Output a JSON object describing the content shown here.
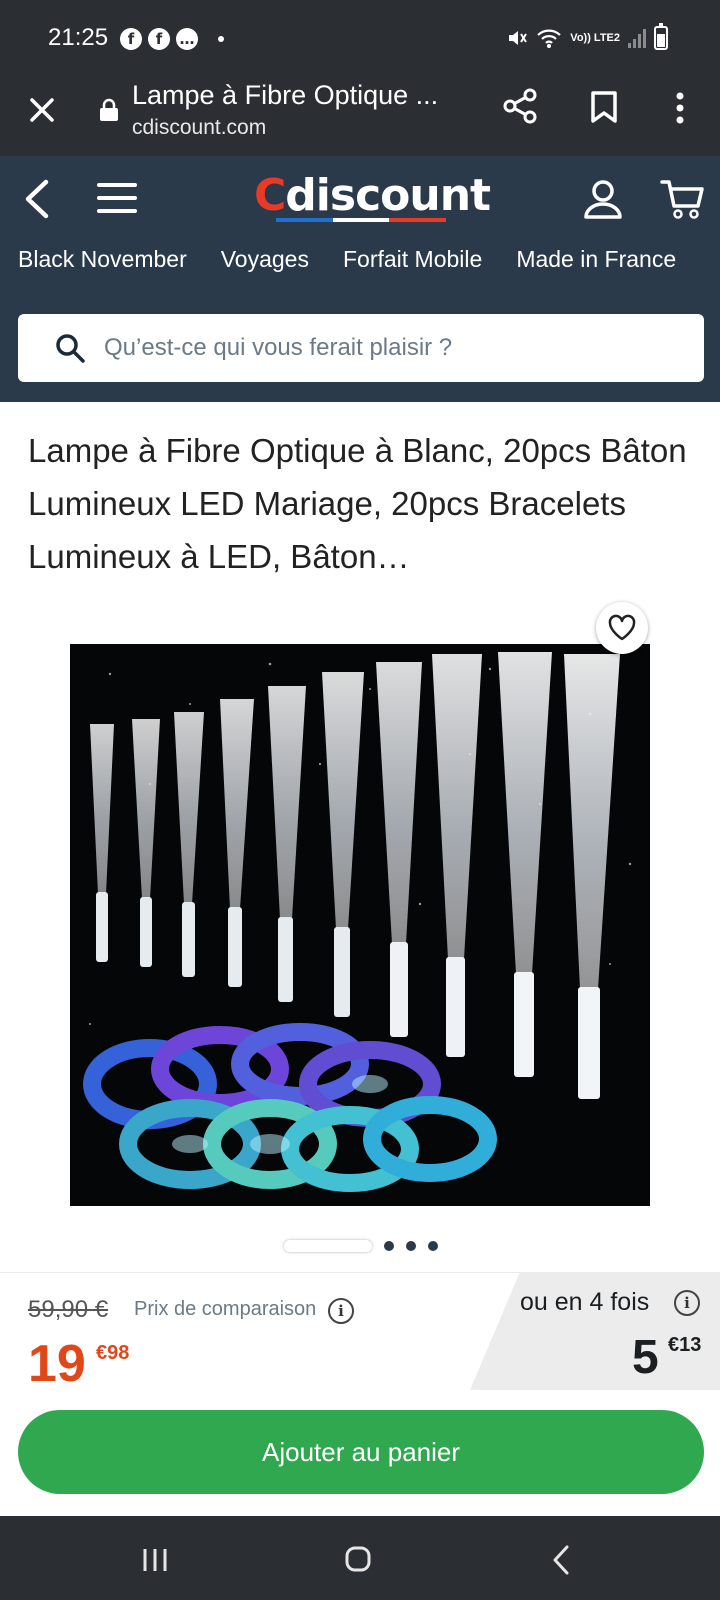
{
  "status_bar": {
    "time": "21:25",
    "left_icons": [
      "facebook-icon",
      "facebook-icon",
      "messenger-icon"
    ],
    "network": "Vo)) LTE2"
  },
  "browser": {
    "page_title": "Lampe à Fibre Optique ...",
    "url": "cdiscount.com"
  },
  "header": {
    "logo_first": "C",
    "logo_rest": "discount",
    "nav_items": [
      "Black November",
      "Voyages",
      "Forfait Mobile",
      "Made in France"
    ],
    "search_placeholder": "Qu’est-ce qui vous ferait plaisir ?"
  },
  "product": {
    "title": "Lampe à Fibre Optique à Blanc, 20pcs Bâton Lumineux LED Mariage, 20pcs Bracelets Lumineux à LED, Bâton…",
    "carousel_dots": 3
  },
  "pricing": {
    "old_price": "59,90 €",
    "compare_label": "Prix de comparaison",
    "price_euros": "19",
    "price_cents": "€98",
    "installment_label": "ou en 4 fois",
    "installment_euros": "5",
    "installment_cents": "€13",
    "info_glyph": "i"
  },
  "actions": {
    "add_to_cart": "Ajouter au panier"
  },
  "colors": {
    "header_bg": "#2b3a4a",
    "accent_price": "#e0481b",
    "cta_green": "#2fa84f"
  }
}
